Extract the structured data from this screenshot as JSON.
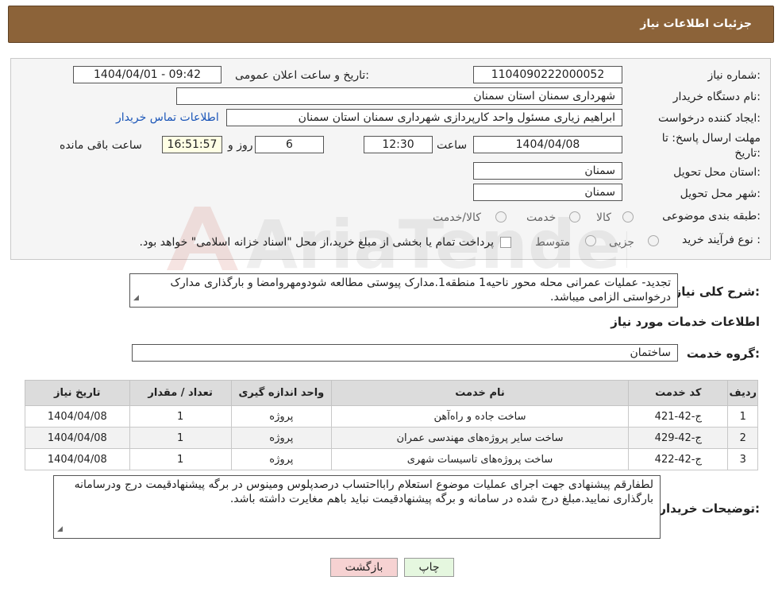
{
  "header": {
    "title": "جزئیات اطلاعات نیاز"
  },
  "form": {
    "need_number_label": "شماره نیاز:",
    "need_number": "1104090222000052",
    "announce_label": "تاریخ و ساعت اعلان عمومی:",
    "announce_value": "1404/04/01 - 09:42",
    "buyer_org_label": "نام دستگاه خریدار:",
    "buyer_org": "شهرداری سمنان استان سمنان",
    "creator_label": "ایجاد کننده درخواست:",
    "creator": "ابراهیم زیاری مسئول واحد کارپردازی شهرداری سمنان استان سمنان",
    "contact_link": "اطلاعات تماس خریدار",
    "deadline_label_1": "مهلت ارسال پاسخ: تا",
    "deadline_label_2": "تاریخ:",
    "deadline_date": "1404/04/08",
    "time_label": "ساعت",
    "deadline_time": "12:30",
    "days": "6",
    "days_label": "روز و",
    "remaining_time": "16:51:57",
    "remaining_label": "ساعت باقی مانده",
    "province_label": "استان محل تحویل:",
    "province": "سمنان",
    "city_label": "شهر محل تحویل:",
    "city": "سمنان",
    "category_label": "طبقه بندی موضوعی:",
    "category_options": [
      "کالا",
      "خدمت",
      "کالا/خدمت"
    ],
    "process_label": "نوع فرآیند خرید :",
    "process_options": [
      "جزیی",
      "متوسط"
    ],
    "process_note": "پرداخت تمام یا بخشی از مبلغ خرید،از محل \"اسناد خزانه اسلامی\" خواهد بود."
  },
  "description": {
    "label": "شرح کلی نیاز:",
    "text": "تجدید- عملیات عمرانی محله محور ناحیه1 منطقه1.مدارک پیوستی مطالعه شودومهروامضا و بارگذاری مدارک درخواستی الزامی میباشد."
  },
  "services": {
    "section_title": "اطلاعات خدمات مورد نیاز",
    "group_label": "گروه خدمت:",
    "group_value": "ساختمان",
    "columns": [
      "ردیف",
      "کد خدمت",
      "نام خدمت",
      "واحد اندازه گیری",
      "تعداد / مقدار",
      "تاریخ نیاز"
    ],
    "rows": [
      [
        "1",
        "ج-42-421",
        "ساخت جاده و راه‌آهن",
        "پروژه",
        "1",
        "1404/04/08"
      ],
      [
        "2",
        "ج-42-429",
        "ساخت سایر پروژه‌های مهندسی عمران",
        "پروژه",
        "1",
        "1404/04/08"
      ],
      [
        "3",
        "ج-42-422",
        "ساخت پروژه‌های تاسیسات شهری",
        "پروژه",
        "1",
        "1404/04/08"
      ]
    ]
  },
  "buyer_notes": {
    "label": "توضیحات خریدار:",
    "text": "لطفارقم پیشنهادی جهت اجرای عملیات موضوع استعلام رابااحتساب درصدپلوس ومینوس در برگه پیشنهادقیمت درج ودرسامانه بارگذاری نمایید.مبلغ درج شده در سامانه و برگه پیشنهادقیمت نباید باهم مغایرت داشته باشد."
  },
  "buttons": {
    "print": "چاپ",
    "back": "بازگشت"
  },
  "watermark": {
    "text": "AriaTender.net"
  },
  "colors": {
    "header": "#8c6339",
    "link": "#1a55b8",
    "back_button": "#f6d2d2",
    "print_button": "#e5f7df"
  }
}
